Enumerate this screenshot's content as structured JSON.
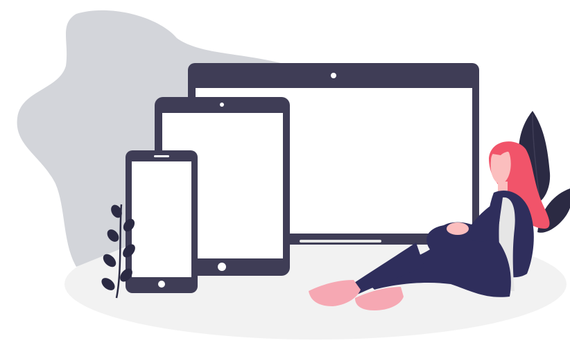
{
  "illustration": {
    "subject": "responsive-devices-woman-sitting",
    "colors": {
      "background": "#ffffff",
      "blob": "#d3d5da",
      "floor": "#f2f2f2",
      "device_frame": "#3f3d56",
      "device_screen": "#ffffff",
      "hair": "#f1546a",
      "skin": "#fbbebe",
      "outfit": "#2f2e5c",
      "shoes": "#f6a8b3",
      "leaves": "#2b2a43"
    }
  }
}
